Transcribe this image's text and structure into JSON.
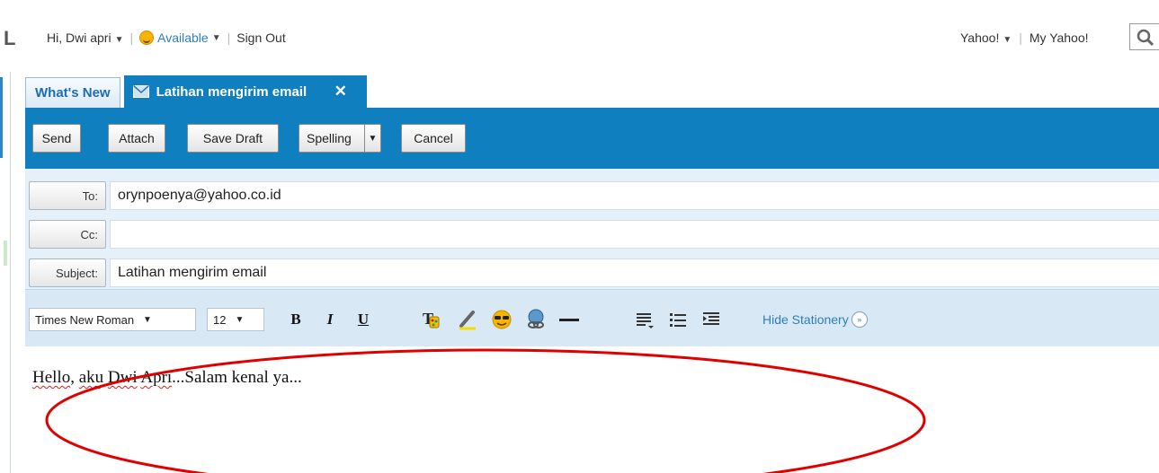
{
  "header": {
    "logo_fragment": "L",
    "greeting": "Hi, Dwi apri",
    "status": "Available",
    "sign_out": "Sign Out",
    "yahoo_menu": "Yahoo!",
    "my_yahoo": "My Yahoo!"
  },
  "tabs": [
    {
      "label": "What's New"
    },
    {
      "label": "Latihan mengirim email",
      "active": true
    }
  ],
  "toolbar": {
    "send": "Send",
    "attach": "Attach",
    "save_draft": "Save Draft",
    "spelling": "Spelling",
    "cancel": "Cancel"
  },
  "compose": {
    "to_label": "To:",
    "to_value": "orynpoenya@yahoo.co.id",
    "cc_label": "Cc:",
    "cc_value": "",
    "subject_label": "Subject:",
    "subject_value": "Latihan mengirim email"
  },
  "format_bar": {
    "font": "Times New Roman",
    "size": "12",
    "bold": "B",
    "italic": "I",
    "underline": "U",
    "icons": [
      "text-color-icon",
      "highlight-icon",
      "emoticon-icon",
      "insert-link-icon",
      "horizontal-line-icon",
      "align-icon",
      "bullet-list-icon",
      "indent-icon"
    ],
    "hide_stationery": "Hide Stationery"
  },
  "body": {
    "word_1": "Hello",
    "punct_1": ", ",
    "word_2": "aku",
    "space_1": " ",
    "word_3": "Dwi",
    "space_2": " ",
    "word_4": "Apri",
    "rest": "...Salam kenal ya..."
  },
  "colors": {
    "accent_blue": "#0f7fc0",
    "link_blue": "#2a7fc0",
    "annotation_red": "#e00000"
  }
}
